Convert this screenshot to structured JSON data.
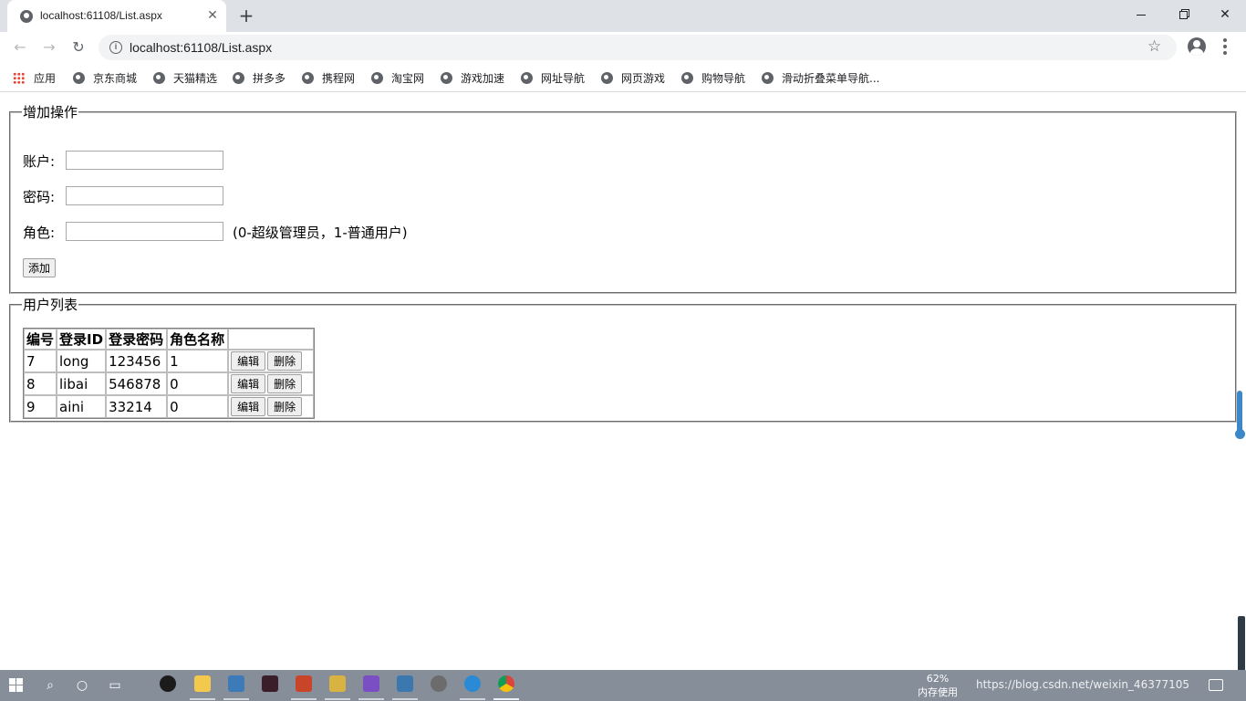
{
  "browser": {
    "tab_title": "localhost:61108/List.aspx",
    "tab_close": "✕",
    "new_tab": "+",
    "url": "localhost:61108/List.aspx",
    "bookmarks": [
      {
        "label": "应用",
        "icon": "apps-grid-icon"
      },
      {
        "label": "京东商城",
        "icon": "globe-icon"
      },
      {
        "label": "天猫精选",
        "icon": "globe-icon"
      },
      {
        "label": "拼多多",
        "icon": "globe-icon"
      },
      {
        "label": "携程网",
        "icon": "globe-icon"
      },
      {
        "label": "淘宝网",
        "icon": "globe-icon"
      },
      {
        "label": "游戏加速",
        "icon": "globe-icon"
      },
      {
        "label": "网址导航",
        "icon": "globe-icon"
      },
      {
        "label": "网页游戏",
        "icon": "globe-icon"
      },
      {
        "label": "购物导航",
        "icon": "globe-icon"
      },
      {
        "label": "滑动折叠菜单导航...",
        "icon": "globe-icon"
      }
    ]
  },
  "add_section": {
    "legend": "增加操作",
    "account_label": "账户:",
    "account_value": "",
    "password_label": "密码:",
    "password_value": "",
    "role_label": "角色:",
    "role_value": "",
    "role_hint": "(0-超级管理员，1-普通用户)",
    "add_button": "添加"
  },
  "list_section": {
    "legend": "用户列表",
    "columns": [
      "编号",
      "登录ID",
      "登录密码",
      "角色名称",
      ""
    ],
    "rows": [
      {
        "id": "7",
        "login": "long",
        "password": "123456",
        "role": "1"
      },
      {
        "id": "8",
        "login": "libai",
        "password": "546878",
        "role": "0"
      },
      {
        "id": "9",
        "login": "aini",
        "password": "33214",
        "role": "0"
      }
    ],
    "edit_label": "编辑",
    "delete_label": "删除"
  },
  "taskbar": {
    "mem_percent": "62%",
    "mem_label": "内存使用",
    "tray_text": "https://blog.csdn.net/weixin_46377105"
  },
  "colors": {
    "accent": "#3b87c7",
    "taskbar": "#868e9a",
    "tabstrip": "#dee1e6"
  }
}
